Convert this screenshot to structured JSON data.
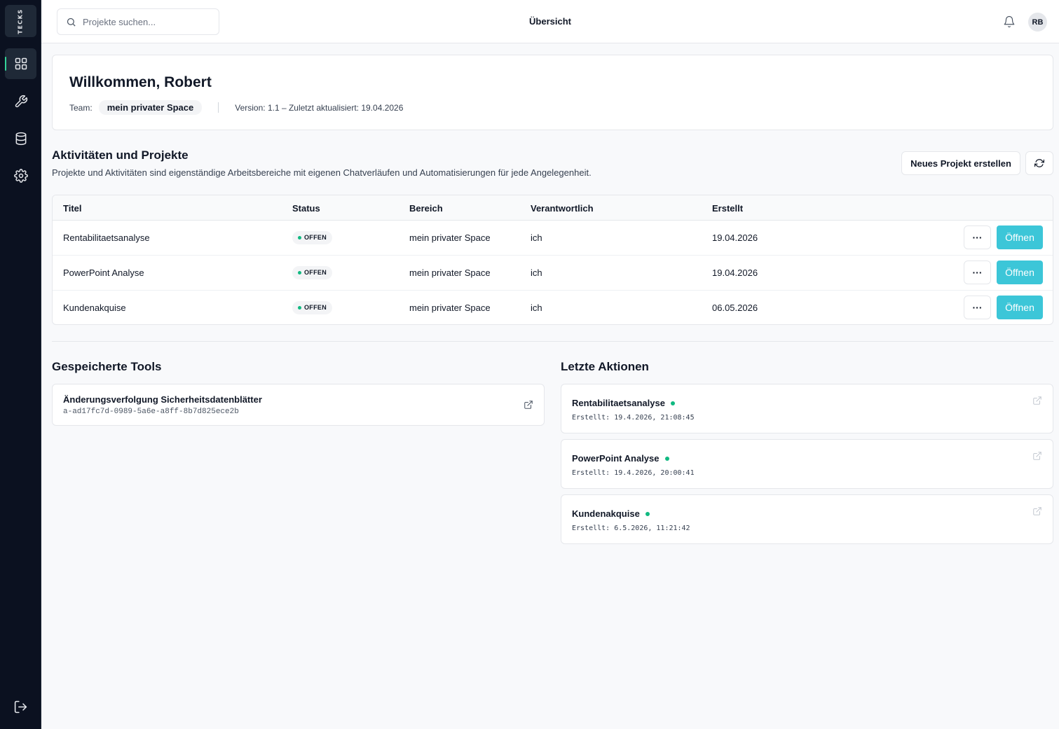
{
  "app": {
    "logo_text": "TECKS"
  },
  "topbar": {
    "search_placeholder": "Projekte suchen...",
    "title": "Übersicht",
    "avatar_initials": "RB"
  },
  "welcome": {
    "heading": "Willkommen, Robert",
    "team_label": "Team:",
    "team_name": "mein privater Space",
    "version_text": "Version: 1.1 – Zuletzt aktualisiert: 19.04.2026"
  },
  "projects": {
    "title": "Aktivitäten und Projekte",
    "description": "Projekte und Aktivitäten sind eigenständige Arbeitsbereiche mit eigenen Chatverläufen und Automatisierungen für jede Angelegenheit.",
    "new_button": "Neues Projekt erstellen",
    "columns": [
      "Titel",
      "Status",
      "Bereich",
      "Verantwortlich",
      "Erstellt"
    ],
    "rows": [
      {
        "title": "Rentabilitaetsanalyse",
        "status": "OFFEN",
        "area": "mein privater Space",
        "owner": "ich",
        "created": "19.04.2026",
        "more": "···",
        "open": "Öffnen"
      },
      {
        "title": "PowerPoint Analyse",
        "status": "OFFEN",
        "area": "mein privater Space",
        "owner": "ich",
        "created": "19.04.2026",
        "more": "···",
        "open": "Öffnen"
      },
      {
        "title": "Kundenakquise",
        "status": "OFFEN",
        "area": "mein privater Space",
        "owner": "ich",
        "created": "06.05.2026",
        "more": "···",
        "open": "Öffnen"
      }
    ]
  },
  "tools": {
    "title": "Gespeicherte Tools",
    "items": [
      {
        "name": "Änderungsverfolgung Sicherheitsdatenblätter",
        "id": "a-ad17fc7d-0989-5a6e-a8ff-8b7d825ece2b"
      }
    ]
  },
  "actions": {
    "title": "Letzte Aktionen",
    "items": [
      {
        "name": "Rentabilitaetsanalyse",
        "created": "Erstellt: 19.4.2026, 21:08:45"
      },
      {
        "name": "PowerPoint Analyse",
        "created": "Erstellt: 19.4.2026, 20:00:41"
      },
      {
        "name": "Kundenakquise",
        "created": "Erstellt: 6.5.2026, 11:21:42"
      }
    ]
  },
  "colors": {
    "accent": "#3cc6d8",
    "status_green": "#10b981",
    "sidebar_bg": "#0b1120"
  },
  "icons": [
    "dashboard-icon",
    "wrench-icon",
    "database-icon",
    "settings-icon",
    "logout-icon",
    "search-icon",
    "bell-icon",
    "refresh-icon",
    "external-link-icon"
  ]
}
